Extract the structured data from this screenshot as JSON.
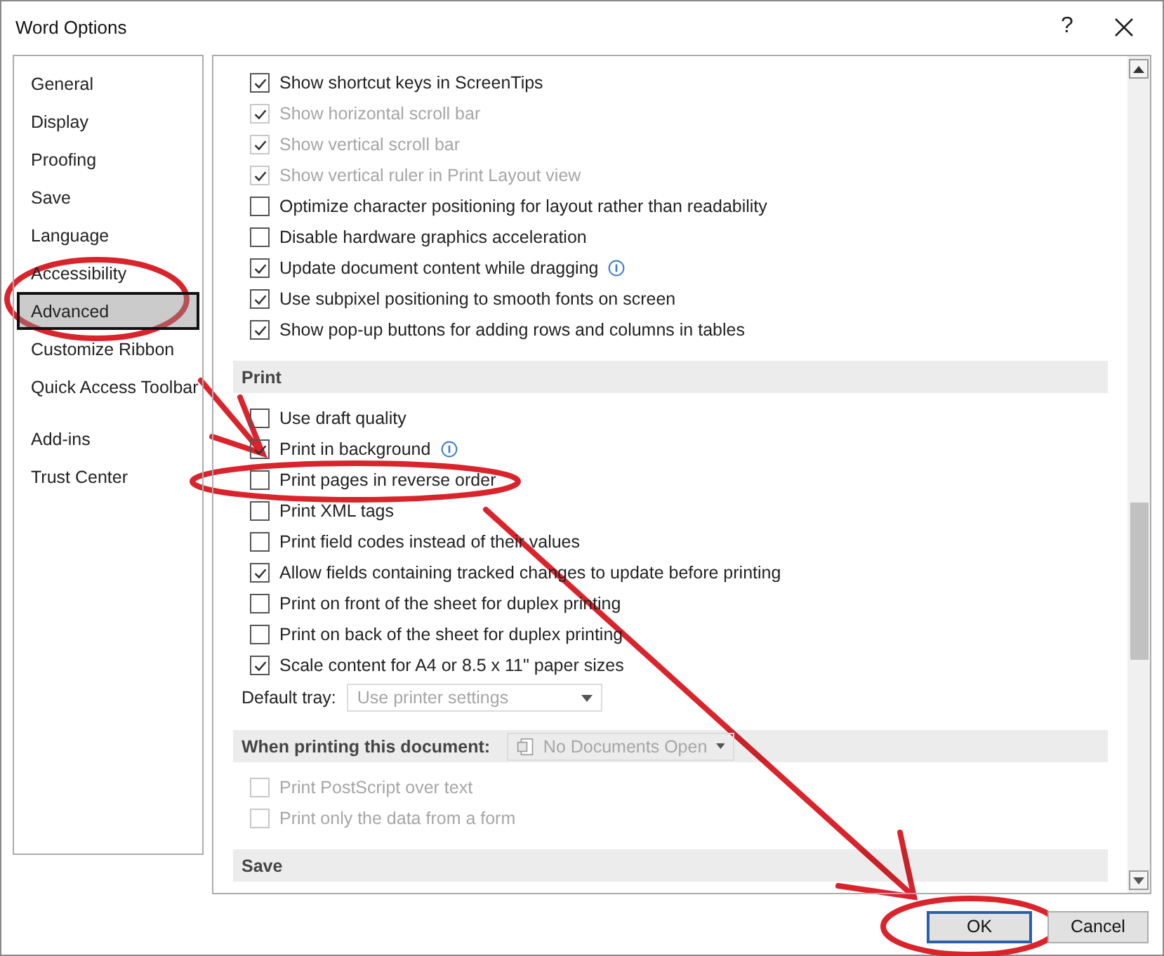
{
  "window": {
    "title": "Word Options",
    "help": "?"
  },
  "sidebar": {
    "groups": [
      [
        {
          "label": "General",
          "selected": false
        },
        {
          "label": "Display",
          "selected": false
        },
        {
          "label": "Proofing",
          "selected": false
        },
        {
          "label": "Save",
          "selected": false
        },
        {
          "label": "Language",
          "selected": false
        },
        {
          "label": "Accessibility",
          "selected": false
        },
        {
          "label": "Advanced",
          "selected": true
        },
        {
          "label": "Customize Ribbon",
          "selected": false
        },
        {
          "label": "Quick Access Toolbar",
          "selected": false
        }
      ],
      [
        {
          "label": "Add-ins",
          "selected": false
        },
        {
          "label": "Trust Center",
          "selected": false
        }
      ]
    ]
  },
  "content": {
    "items": [
      {
        "kind": "checkbox",
        "label": "Show shortcut keys in ScreenTips",
        "checked": true,
        "disabled": false
      },
      {
        "kind": "checkbox",
        "label": "Show horizontal scroll bar",
        "checked": true,
        "disabled": true
      },
      {
        "kind": "checkbox",
        "label": "Show vertical scroll bar",
        "checked": true,
        "disabled": true
      },
      {
        "kind": "checkbox",
        "label": "Show vertical ruler in Print Layout view",
        "checked": true,
        "disabled": true
      },
      {
        "kind": "checkbox",
        "label": "Optimize character positioning for layout rather than readability",
        "checked": false,
        "disabled": false
      },
      {
        "kind": "checkbox",
        "label": "Disable hardware graphics acceleration",
        "checked": false,
        "disabled": false
      },
      {
        "kind": "checkbox",
        "label": "Update document content while dragging",
        "checked": true,
        "disabled": false,
        "info": true
      },
      {
        "kind": "checkbox",
        "label": "Use subpixel positioning to smooth fonts on screen",
        "checked": true,
        "disabled": false
      },
      {
        "kind": "checkbox",
        "label": "Show pop-up buttons for adding rows and columns in tables",
        "checked": true,
        "disabled": false
      },
      {
        "kind": "section",
        "label": "Print"
      },
      {
        "kind": "checkbox",
        "label": "Use draft quality",
        "checked": false,
        "disabled": false
      },
      {
        "kind": "checkbox",
        "label": "Print in background",
        "checked": true,
        "disabled": false,
        "info": true
      },
      {
        "kind": "checkbox",
        "label": "Print pages in reverse order",
        "checked": false,
        "disabled": false
      },
      {
        "kind": "checkbox",
        "label": "Print XML tags",
        "checked": false,
        "disabled": false
      },
      {
        "kind": "checkbox",
        "label": "Print field codes instead of their values",
        "checked": false,
        "disabled": false
      },
      {
        "kind": "checkbox",
        "label": "Allow fields containing tracked changes to update before printing",
        "checked": true,
        "disabled": false
      },
      {
        "kind": "checkbox",
        "label": "Print on front of the sheet for duplex printing",
        "checked": false,
        "disabled": false
      },
      {
        "kind": "checkbox",
        "label": "Print on back of the sheet for duplex printing",
        "checked": false,
        "disabled": false
      },
      {
        "kind": "checkbox",
        "label": "Scale content for A4 or 8.5 x 11\" paper sizes",
        "checked": true,
        "disabled": false
      },
      {
        "kind": "select",
        "label": "Default tray:",
        "value": "Use printer settings"
      },
      {
        "kind": "section",
        "label": "When printing this document:",
        "value": "No Documents Open"
      },
      {
        "kind": "checkbox",
        "label": "Print PostScript over text",
        "checked": false,
        "disabled": true
      },
      {
        "kind": "checkbox",
        "label": "Print only the data from a form",
        "checked": false,
        "disabled": true
      },
      {
        "kind": "section",
        "label": "Save"
      }
    ]
  },
  "buttons": [
    {
      "label": "OK",
      "default": true
    },
    {
      "label": "Cancel",
      "default": false
    }
  ]
}
